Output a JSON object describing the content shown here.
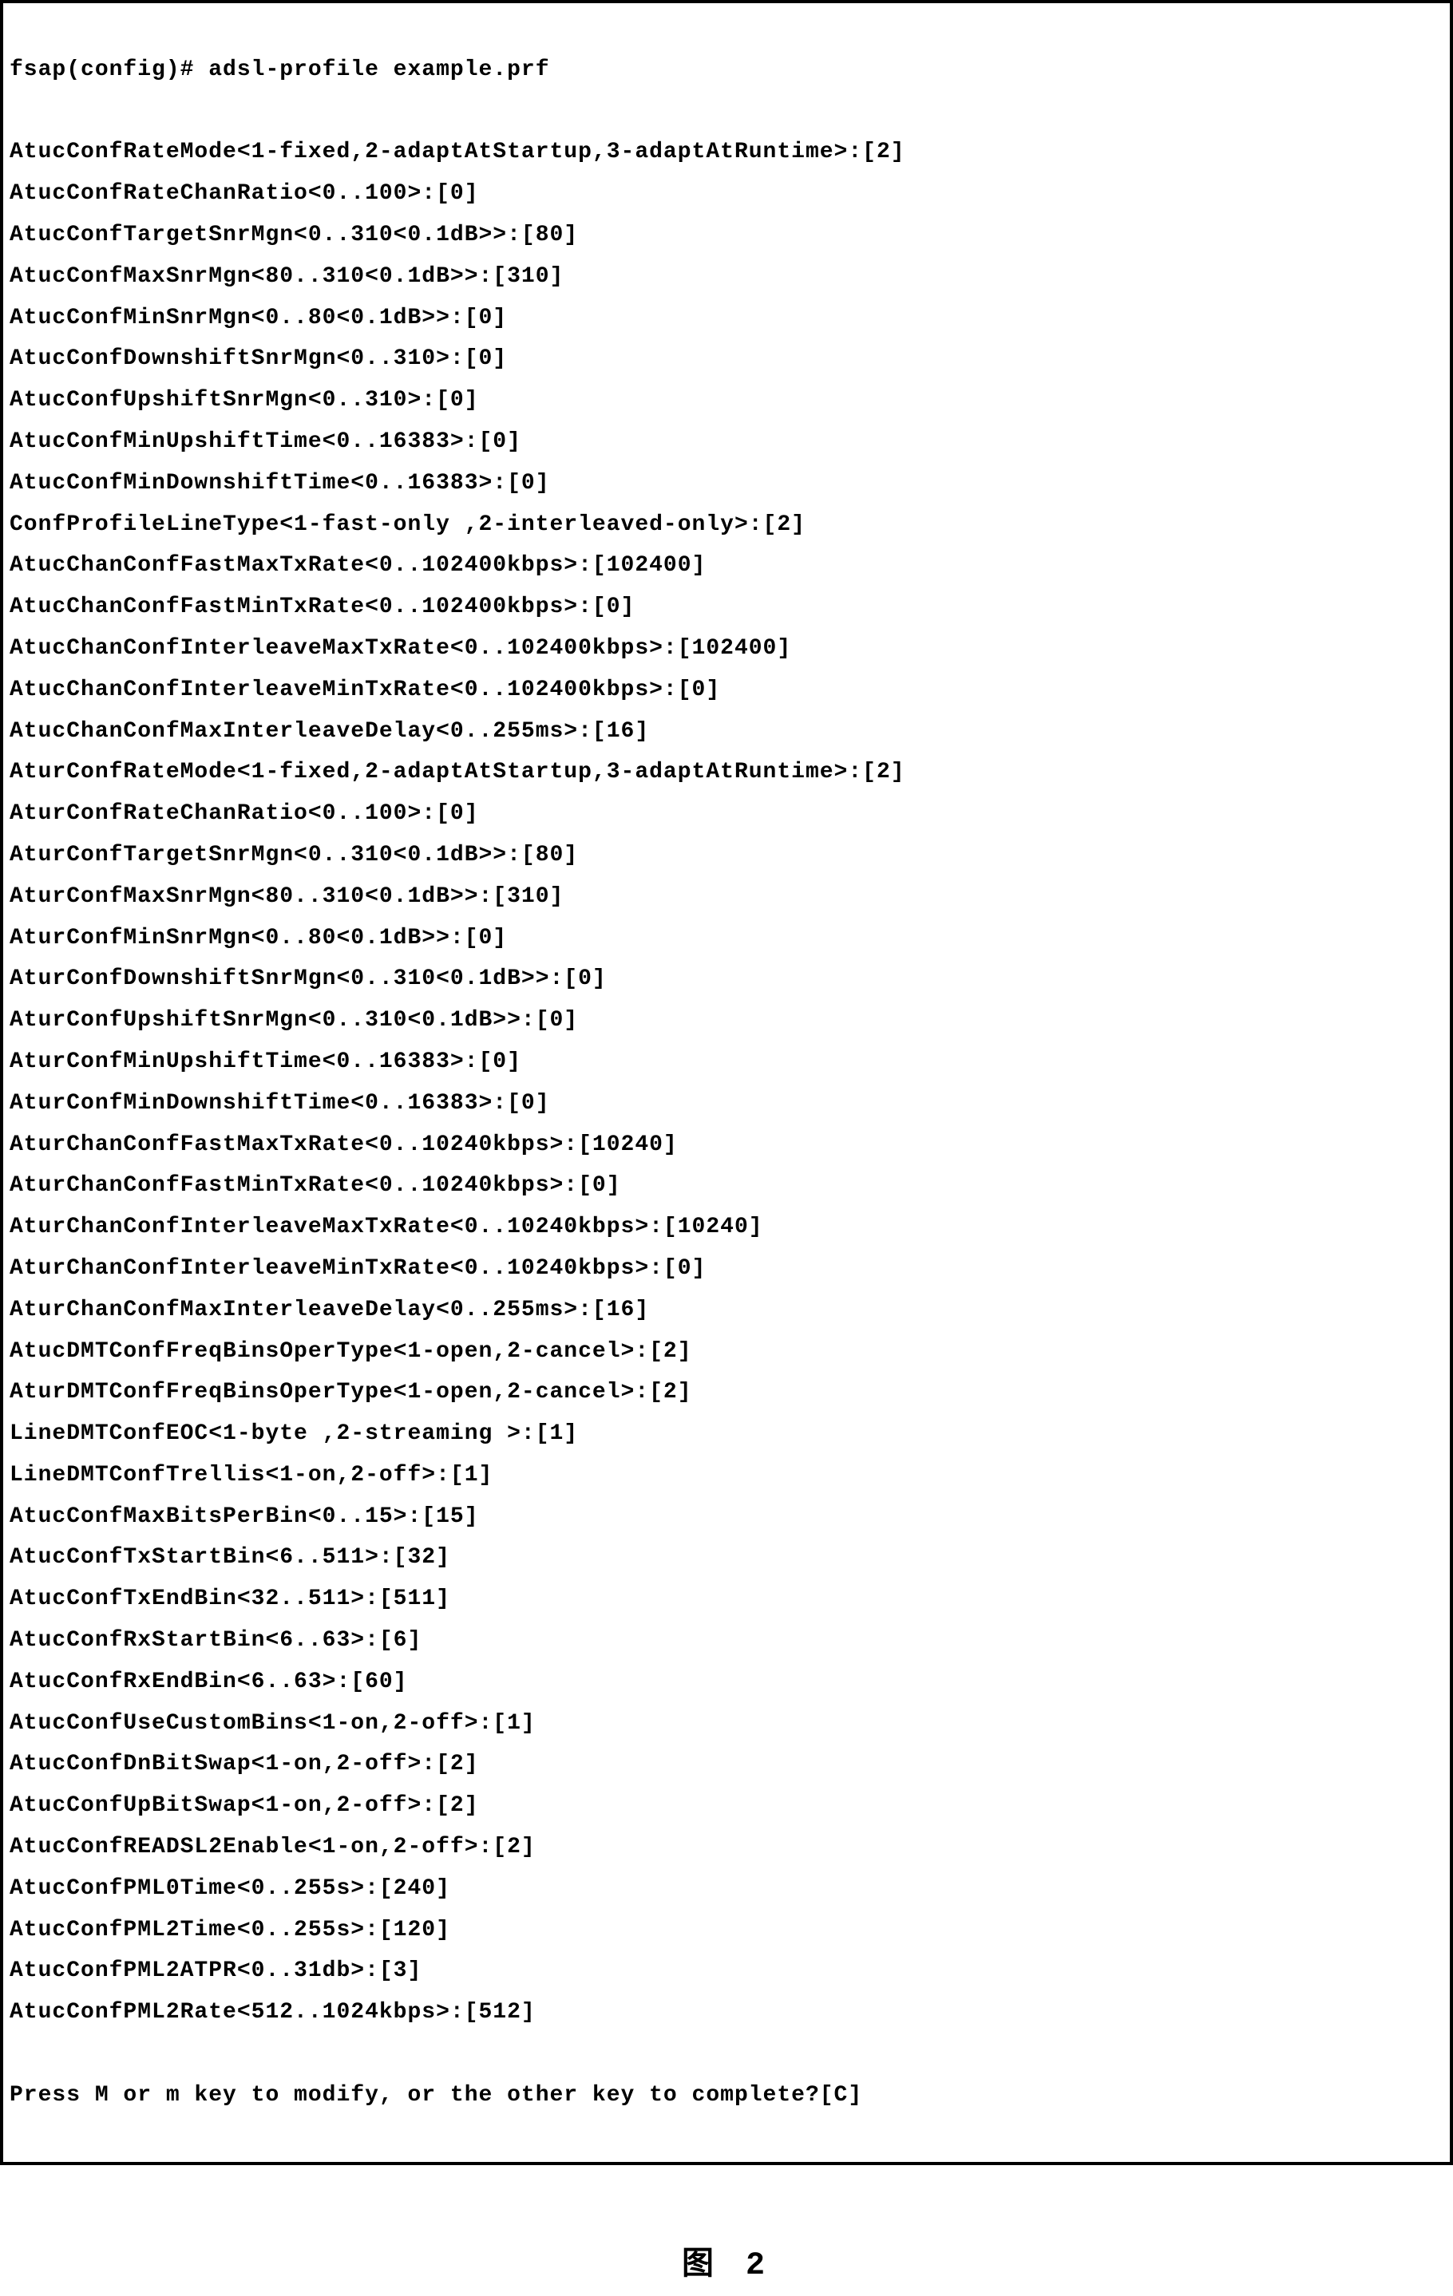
{
  "prompt": "fsap(config)# adsl-profile example.prf",
  "lines": [
    {
      "name": "AtucConfRateMode",
      "range": "<1-fixed,2-adaptAtStartup,3-adaptAtRuntime>",
      "value": "2"
    },
    {
      "name": "AtucConfRateChanRatio",
      "range": "<0..100>",
      "value": "0"
    },
    {
      "name": "AtucConfTargetSnrMgn",
      "range": "<0..310<0.1dB>>",
      "value": "80"
    },
    {
      "name": "AtucConfMaxSnrMgn",
      "range": "<80..310<0.1dB>>",
      "value": "310"
    },
    {
      "name": "AtucConfMinSnrMgn",
      "range": "<0..80<0.1dB>>",
      "value": "0"
    },
    {
      "name": "AtucConfDownshiftSnrMgn",
      "range": "<0..310>",
      "value": "0"
    },
    {
      "name": "AtucConfUpshiftSnrMgn",
      "range": "<0..310>",
      "value": "0"
    },
    {
      "name": "AtucConfMinUpshiftTime",
      "range": "<0..16383>",
      "value": "0"
    },
    {
      "name": "AtucConfMinDownshiftTime",
      "range": "<0..16383>",
      "value": "0"
    },
    {
      "name": "ConfProfileLineType",
      "range": "<1-fast-only ,2-interleaved-only>",
      "value": "2"
    },
    {
      "name": "AtucChanConfFastMaxTxRate",
      "range": "<0..102400kbps>",
      "value": "102400"
    },
    {
      "name": "AtucChanConfFastMinTxRate",
      "range": "<0..102400kbps>",
      "value": "0"
    },
    {
      "name": "AtucChanConfInterleaveMaxTxRate",
      "range": "<0..102400kbps>",
      "value": "102400"
    },
    {
      "name": "AtucChanConfInterleaveMinTxRate",
      "range": "<0..102400kbps>",
      "value": "0"
    },
    {
      "name": "AtucChanConfMaxInterleaveDelay",
      "range": "<0..255ms>",
      "value": "16"
    },
    {
      "name": "AturConfRateMode",
      "range": "<1-fixed,2-adaptAtStartup,3-adaptAtRuntime>",
      "value": "2"
    },
    {
      "name": "AturConfRateChanRatio",
      "range": "<0..100>",
      "value": "0"
    },
    {
      "name": "AturConfTargetSnrMgn",
      "range": "<0..310<0.1dB>>",
      "value": "80"
    },
    {
      "name": "AturConfMaxSnrMgn",
      "range": "<80..310<0.1dB>>",
      "value": "310"
    },
    {
      "name": "AturConfMinSnrMgn",
      "range": "<0..80<0.1dB>>",
      "value": "0"
    },
    {
      "name": "AturConfDownshiftSnrMgn",
      "range": "<0..310<0.1dB>>",
      "value": "0"
    },
    {
      "name": "AturConfUpshiftSnrMgn",
      "range": "<0..310<0.1dB>>",
      "value": "0"
    },
    {
      "name": "AturConfMinUpshiftTime",
      "range": "<0..16383>",
      "value": "0"
    },
    {
      "name": "AturConfMinDownshiftTime",
      "range": "<0..16383>",
      "value": "0"
    },
    {
      "name": "AturChanConfFastMaxTxRate",
      "range": "<0..10240kbps>",
      "value": "10240"
    },
    {
      "name": "AturChanConfFastMinTxRate",
      "range": "<0..10240kbps>",
      "value": "0"
    },
    {
      "name": "AturChanConfInterleaveMaxTxRate",
      "range": "<0..10240kbps>",
      "value": "10240"
    },
    {
      "name": "AturChanConfInterleaveMinTxRate",
      "range": "<0..10240kbps>",
      "value": "0"
    },
    {
      "name": "AturChanConfMaxInterleaveDelay",
      "range": "<0..255ms>",
      "value": "16"
    },
    {
      "name": "AtucDMTConfFreqBinsOperType",
      "range": "<1-open,2-cancel>",
      "value": "2"
    },
    {
      "name": "AturDMTConfFreqBinsOperType",
      "range": "<1-open,2-cancel>",
      "value": "2"
    },
    {
      "name": "LineDMTConfEOC",
      "range": "<1-byte ,2-streaming >",
      "value": "1"
    },
    {
      "name": "LineDMTConfTrellis",
      "range": "<1-on,2-off>",
      "value": "1"
    },
    {
      "name": "AtucConfMaxBitsPerBin",
      "range": "<0..15>",
      "value": "15"
    },
    {
      "name": "AtucConfTxStartBin",
      "range": "<6..511>",
      "value": "32"
    },
    {
      "name": "AtucConfTxEndBin",
      "range": "<32..511>",
      "value": "511"
    },
    {
      "name": "AtucConfRxStartBin",
      "range": "<6..63>",
      "value": "6"
    },
    {
      "name": "AtucConfRxEndBin",
      "range": "<6..63>",
      "value": "60"
    },
    {
      "name": "AtucConfUseCustomBins",
      "range": "<1-on,2-off>",
      "value": "1"
    },
    {
      "name": "AtucConfDnBitSwap",
      "range": "<1-on,2-off>",
      "value": "2"
    },
    {
      "name": "AtucConfUpBitSwap",
      "range": "<1-on,2-off>",
      "value": "2"
    },
    {
      "name": "AtucConfREADSL2Enable",
      "range": "<1-on,2-off>",
      "value": "2"
    },
    {
      "name": "AtucConfPML0Time",
      "range": "<0..255s>",
      "value": "240"
    },
    {
      "name": "AtucConfPML2Time",
      "range": "<0..255s>",
      "value": "120"
    },
    {
      "name": "AtucConfPML2ATPR",
      "range": "<0..31db>",
      "value": "3"
    },
    {
      "name": "AtucConfPML2Rate",
      "range": "<512..1024kbps>",
      "value": "512"
    }
  ],
  "footer": "Press M or m key to modify, or the other key to complete?[C]",
  "caption": "图   2"
}
